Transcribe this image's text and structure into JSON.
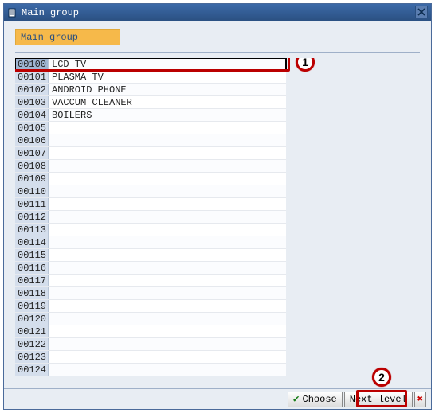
{
  "window": {
    "title": "Main group",
    "group_label": "Main group"
  },
  "rows": [
    {
      "code": "00100",
      "label": "LCD TV"
    },
    {
      "code": "00101",
      "label": "PLASMA TV"
    },
    {
      "code": "00102",
      "label": "ANDROID PHONE"
    },
    {
      "code": "00103",
      "label": "VACCUM CLEANER"
    },
    {
      "code": "00104",
      "label": "BOILERS"
    },
    {
      "code": "00105",
      "label": ""
    },
    {
      "code": "00106",
      "label": ""
    },
    {
      "code": "00107",
      "label": ""
    },
    {
      "code": "00108",
      "label": ""
    },
    {
      "code": "00109",
      "label": ""
    },
    {
      "code": "00110",
      "label": ""
    },
    {
      "code": "00111",
      "label": ""
    },
    {
      "code": "00112",
      "label": ""
    },
    {
      "code": "00113",
      "label": ""
    },
    {
      "code": "00114",
      "label": ""
    },
    {
      "code": "00115",
      "label": ""
    },
    {
      "code": "00116",
      "label": ""
    },
    {
      "code": "00117",
      "label": ""
    },
    {
      "code": "00118",
      "label": ""
    },
    {
      "code": "00119",
      "label": ""
    },
    {
      "code": "00120",
      "label": ""
    },
    {
      "code": "00121",
      "label": ""
    },
    {
      "code": "00122",
      "label": ""
    },
    {
      "code": "00123",
      "label": ""
    },
    {
      "code": "00124",
      "label": ""
    }
  ],
  "selected_index": 0,
  "buttons": {
    "choose": "Choose",
    "next_level": "Next level"
  },
  "callouts": {
    "one": "1",
    "two": "2"
  }
}
